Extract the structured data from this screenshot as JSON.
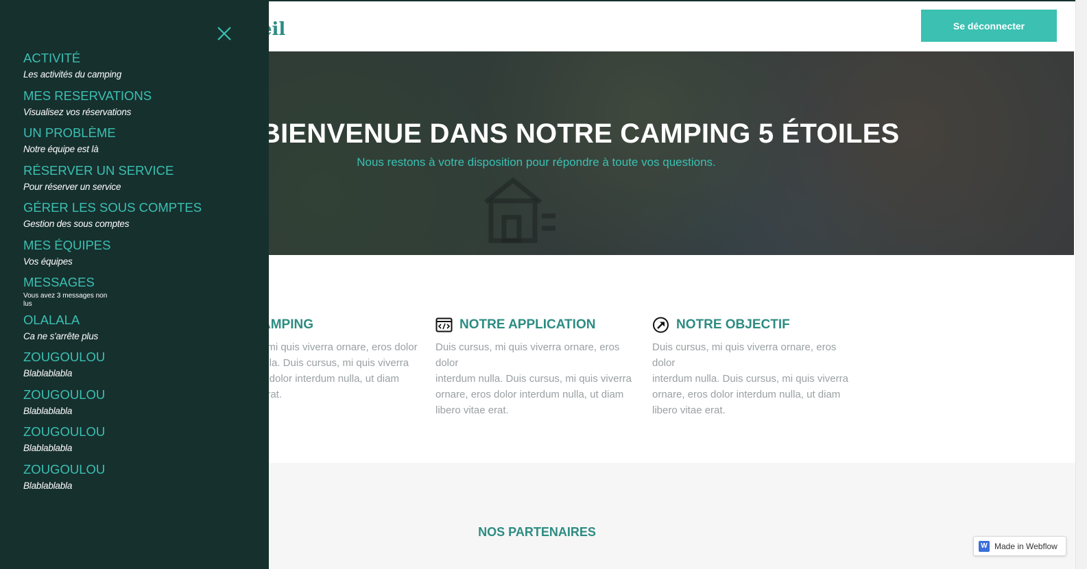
{
  "navbar": {
    "brand_partial": "eil",
    "logout_label": "Se déconnecter"
  },
  "hero": {
    "title": "BIENVENUE DANS NOTRE CAMPING 5 ÉTOILES",
    "subtitle": "Nous restons à votre disposition pour répondre à toute vos questions."
  },
  "features": [
    {
      "title": "AMPING",
      "icon": "camping-icon",
      "lines": [
        ", mi quis viverra ornare, eros dolor",
        "ulla. Duis cursus, mi quis viverra",
        "s dolor interdum nulla, ut diam",
        "erat."
      ]
    },
    {
      "title": "NOTRE APPLICATION",
      "icon": "code-window-icon",
      "lines": [
        "Duis cursus, mi quis viverra ornare, eros dolor",
        "interdum nulla. Duis cursus, mi quis viverra",
        "ornare, eros dolor interdum nulla, ut diam",
        "libero vitae erat."
      ]
    },
    {
      "title": "NOTRE OBJECTIF",
      "icon": "arrow-circle-icon",
      "lines": [
        "Duis cursus, mi quis viverra ornare, eros dolor",
        "interdum nulla. Duis cursus, mi quis viverra",
        "ornare, eros dolor interdum nulla, ut diam",
        "libero vitae erat."
      ]
    }
  ],
  "partners": {
    "title": "NOS PARTENAIRES"
  },
  "webflow_badge": {
    "label": "Made in Webflow"
  },
  "drawer": {
    "close_icon": "close-icon",
    "items": [
      {
        "label": "ACTIVITÉ",
        "desc": "Les activités du camping"
      },
      {
        "label": "MES RESERVATIONS",
        "desc": "Visualisez vos réservations"
      },
      {
        "label": "UN PROBLÈME",
        "desc": "Notre équipe est là"
      },
      {
        "label": "RÉSERVER UN SERVICE",
        "desc": "Pour réserver un service"
      },
      {
        "label": "GÉRER LES SOUS COMPTES",
        "desc": "Gestion des sous comptes"
      },
      {
        "label": "MES ÉQUIPES",
        "desc": "Vos équipes"
      },
      {
        "label": "MESSAGES",
        "desc": "Vous avez 3 messages non lus"
      },
      {
        "label": "OLALALA",
        "desc": "Ca ne s'arrête plus"
      },
      {
        "label": "ZOUGOULOU",
        "desc": "Blablablabla"
      },
      {
        "label": "ZOUGOULOU",
        "desc": "Blablablabla"
      },
      {
        "label": "ZOUGOULOU",
        "desc": "Blablablabla"
      },
      {
        "label": "ZOUGOULOU",
        "desc": "Blablablabla"
      }
    ]
  },
  "colors": {
    "drawer_bg": "#16302e",
    "accent": "#3bc0b2",
    "heading_teal": "#2c8c82"
  }
}
